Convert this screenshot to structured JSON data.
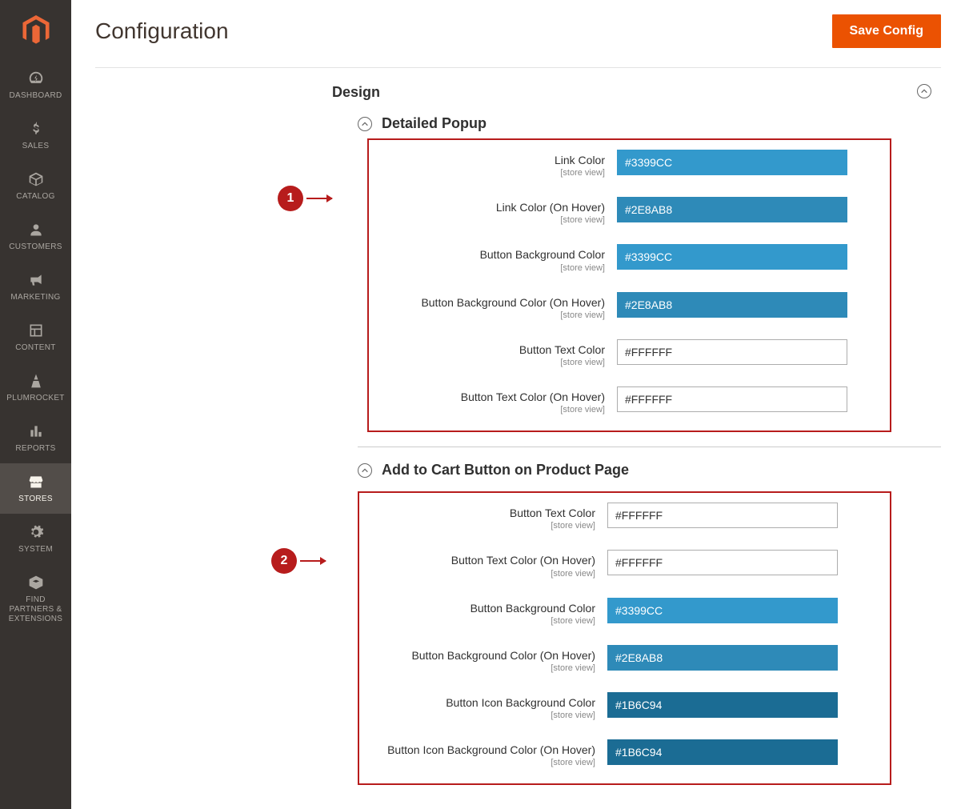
{
  "page": {
    "title": "Configuration",
    "save_button": "Save Config"
  },
  "sidebar": {
    "items": [
      {
        "label": "DASHBOARD"
      },
      {
        "label": "SALES"
      },
      {
        "label": "CATALOG"
      },
      {
        "label": "CUSTOMERS"
      },
      {
        "label": "MARKETING"
      },
      {
        "label": "CONTENT"
      },
      {
        "label": "PLUMROCKET"
      },
      {
        "label": "REPORTS"
      },
      {
        "label": "STORES"
      },
      {
        "label": "SYSTEM"
      },
      {
        "label": "FIND PARTNERS & EXTENSIONS"
      }
    ]
  },
  "design": {
    "title": "Design",
    "section1": {
      "title": "Detailed Popup",
      "fields": [
        {
          "label": "Link Color",
          "scope": "[store view]",
          "value": "#3399CC",
          "bg": "3399cc"
        },
        {
          "label": "Link Color (On Hover)",
          "scope": "[store view]",
          "value": "#2E8AB8",
          "bg": "2e8ab8"
        },
        {
          "label": "Button Background Color",
          "scope": "[store view]",
          "value": "#3399CC",
          "bg": "3399cc"
        },
        {
          "label": "Button Background Color (On Hover)",
          "scope": "[store view]",
          "value": "#2E8AB8",
          "bg": "2e8ab8"
        },
        {
          "label": "Button Text Color",
          "scope": "[store view]",
          "value": "#FFFFFF",
          "bg": "ffffff"
        },
        {
          "label": "Button Text Color (On Hover)",
          "scope": "[store view]",
          "value": "#FFFFFF",
          "bg": "ffffff"
        }
      ]
    },
    "section2": {
      "title": "Add to Cart Button on Product Page",
      "fields": [
        {
          "label": "Button Text Color",
          "scope": "[store view]",
          "value": "#FFFFFF",
          "bg": "ffffff"
        },
        {
          "label": "Button Text Color (On Hover)",
          "scope": "[store view]",
          "value": "#FFFFFF",
          "bg": "ffffff"
        },
        {
          "label": "Button Background Color",
          "scope": "[store view]",
          "value": "#3399CC",
          "bg": "3399cc"
        },
        {
          "label": "Button Background Color (On Hover)",
          "scope": "[store view]",
          "value": "#2E8AB8",
          "bg": "2e8ab8"
        },
        {
          "label": "Button Icon Background Color",
          "scope": "[store view]",
          "value": "#1B6C94",
          "bg": "1b6c94"
        },
        {
          "label": "Button Icon Background Color (On Hover)",
          "scope": "[store view]",
          "value": "#1B6C94",
          "bg": "1b6c94"
        }
      ]
    }
  },
  "annotations": {
    "a1": "1",
    "a2": "2"
  }
}
